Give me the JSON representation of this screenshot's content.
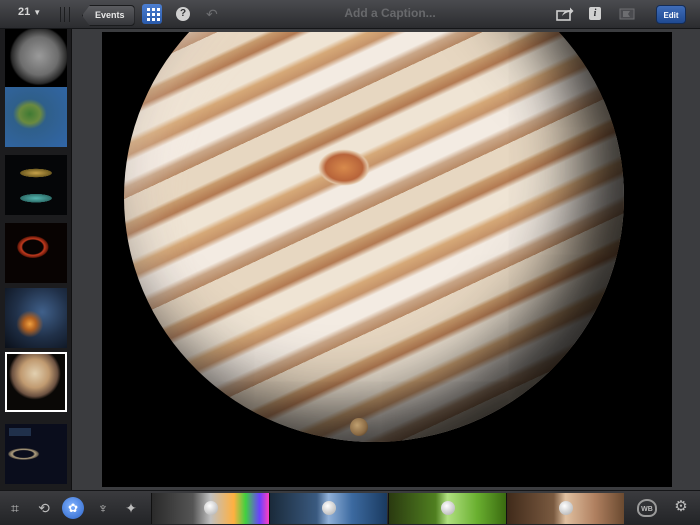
{
  "toolbar": {
    "photo_count": "21",
    "back_label": "Events",
    "caption_placeholder": "Add a Caption...",
    "help_glyph": "?",
    "info_glyph": "i",
    "edit_label": "Edit",
    "icons": [
      "chevron-down-icon",
      "grid-icon",
      "help-icon",
      "undo-icon",
      "share-icon",
      "info-icon",
      "flag-icon"
    ],
    "accent_color": "#2a5aaa"
  },
  "sidebar": {
    "thumbnails": [
      {
        "subject": "moon"
      },
      {
        "subject": "earth-map"
      },
      {
        "subject": "ringed-discs"
      },
      {
        "subject": "red-ring"
      },
      {
        "subject": "nebula"
      },
      {
        "subject": "jupiter",
        "selected": true
      },
      {
        "subject": "solar-system-diagram"
      }
    ]
  },
  "bottombar": {
    "tools": [
      "crop-icon",
      "rotate-icon",
      "palette-icon",
      "brush-icon",
      "effects-icon"
    ],
    "active_tool": "palette-icon",
    "sliders": [
      {
        "name": "exposure",
        "icon": "aperture-icon"
      },
      {
        "name": "sky",
        "icon": "cloud-icon"
      },
      {
        "name": "foliage",
        "icon": "leaf-icon"
      },
      {
        "name": "skin",
        "icon": "person-icon"
      }
    ],
    "wb_label": "WB",
    "settings_icon": "gear-icon"
  }
}
